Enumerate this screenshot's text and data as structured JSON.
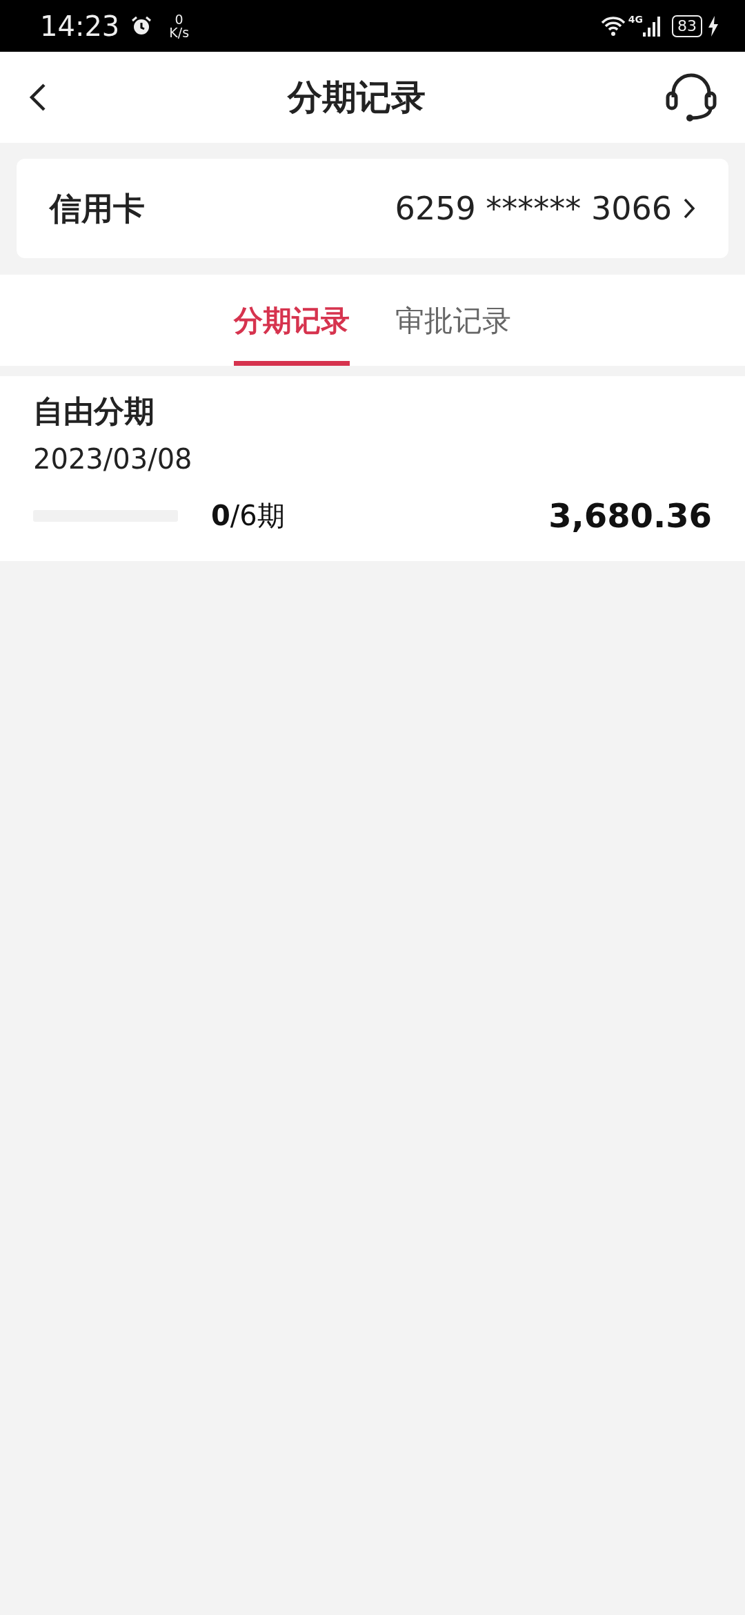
{
  "status_bar": {
    "time": "14:23",
    "speed_value": "0",
    "speed_unit": "K/s",
    "network": "4G",
    "battery": "83"
  },
  "header": {
    "title": "分期记录"
  },
  "card": {
    "label": "信用卡",
    "number": "6259 ****** 3066"
  },
  "tabs": [
    {
      "label": "分期记录",
      "selected": true
    },
    {
      "label": "审批记录",
      "selected": false
    }
  ],
  "records": [
    {
      "title": "自由分期",
      "date": "2023/03/08",
      "periods": "**0**/6期",
      "amount": "3,680.36"
    }
  ]
}
